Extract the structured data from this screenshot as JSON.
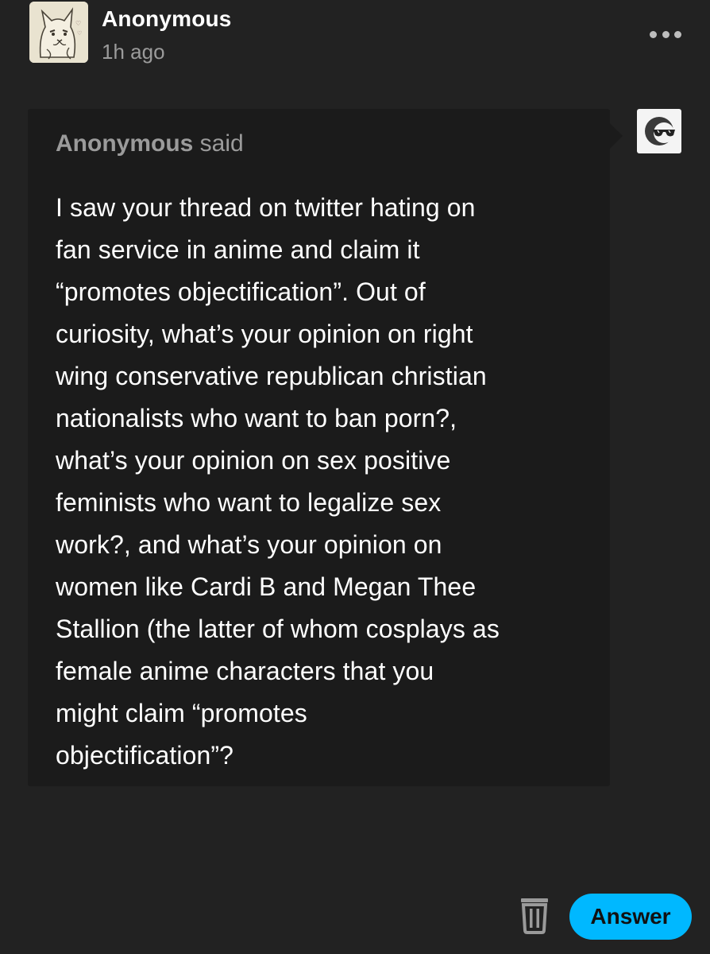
{
  "post": {
    "author": "Anonymous",
    "time": "1h ago",
    "avatar_icon": "cat-sketch-avatar",
    "more_icon": "more-options-icon"
  },
  "ask": {
    "asker_name": "Anonymous",
    "asker_suffix": " said",
    "asker_avatar_icon": "sunglasses-face-icon",
    "question": "I saw your thread on twitter hating on\nfan service in anime and claim it\n“promotes objectification”. Out of\ncuriosity, what’s your opinion on right\nwing conservative republican christian\nnationalists who want to ban porn?,\nwhat’s your opinion on sex positive\nfeminists who want to legalize sex\nwork?, and what’s your opinion on\nwomen like Cardi B and Megan Thee\nStallion (the latter of whom cosplays as\nfemale anime characters that you\nmight claim “promotes\nobjectification”?"
  },
  "actions": {
    "delete_icon": "trash-icon",
    "answer_label": "Answer"
  },
  "colors": {
    "background": "#222222",
    "bubble": "#1b1b1b",
    "accent": "#00b8ff",
    "muted_text": "#9b9b9b"
  }
}
